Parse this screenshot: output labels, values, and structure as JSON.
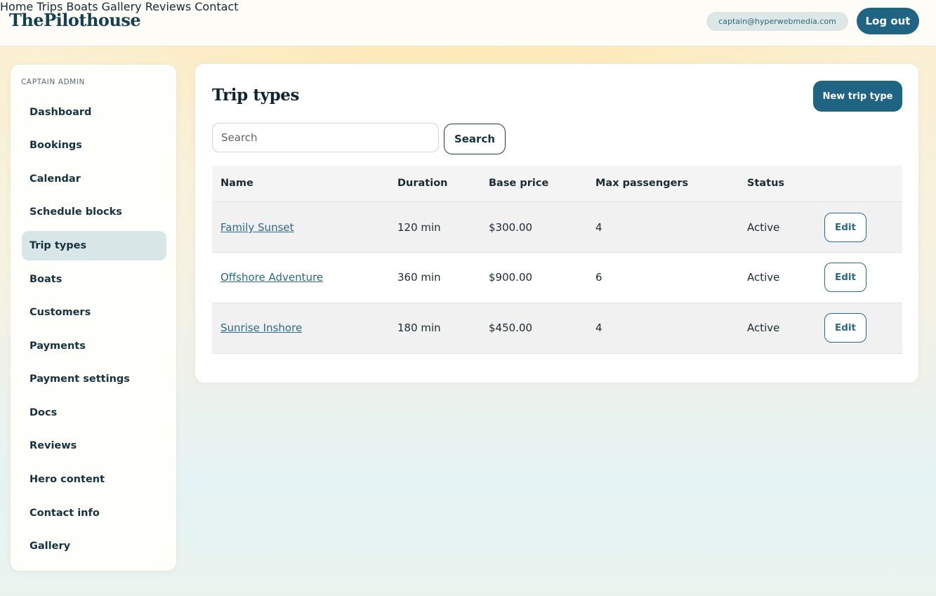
{
  "brand": "ThePilothouse",
  "nav": {
    "items": [
      "Home",
      "Trips",
      "Boats",
      "Gallery",
      "Reviews",
      "Contact"
    ],
    "user_email": "captain@hyperwebmedia.com",
    "logout_label": "Log out"
  },
  "sidebar": {
    "title": "CAPTAIN ADMIN",
    "active": "Trip types",
    "items": [
      {
        "label": "Dashboard"
      },
      {
        "label": "Bookings"
      },
      {
        "label": "Calendar"
      },
      {
        "label": "Schedule blocks"
      },
      {
        "label": "Trip types"
      },
      {
        "label": "Boats"
      },
      {
        "label": "Customers"
      },
      {
        "label": "Payments"
      },
      {
        "label": "Payment settings"
      },
      {
        "label": "Docs"
      },
      {
        "label": "Reviews"
      },
      {
        "label": "Hero content"
      },
      {
        "label": "Contact info"
      },
      {
        "label": "Gallery"
      }
    ]
  },
  "main": {
    "title": "Trip types",
    "new_button_label": "New trip type",
    "search": {
      "placeholder": "Search",
      "value": "",
      "button_label": "Search"
    },
    "table": {
      "columns": [
        "Name",
        "Duration",
        "Base price",
        "Max passengers",
        "Status"
      ],
      "rows": [
        {
          "name": "Family Sunset",
          "duration": "120 min",
          "base_price": "$300.00",
          "max_passengers": "4",
          "status": "Active",
          "action": "Edit"
        },
        {
          "name": "Offshore Adventure",
          "duration": "360 min",
          "base_price": "$900.00",
          "max_passengers": "6",
          "status": "Active",
          "action": "Edit"
        },
        {
          "name": "Sunrise Inshore",
          "duration": "180 min",
          "base_price": "$450.00",
          "max_passengers": "4",
          "status": "Active",
          "action": "Edit"
        }
      ]
    }
  },
  "colors": {
    "primary": "#1f6482",
    "link": "#2a6a84",
    "active_nav_bg": "#d9e6e8"
  }
}
